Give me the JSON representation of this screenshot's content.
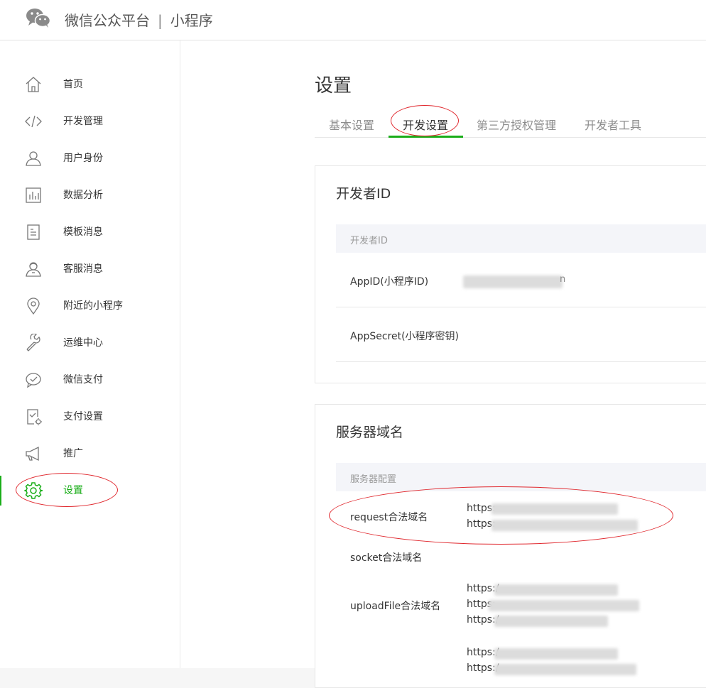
{
  "header": {
    "logo_icon": "wechat-logo-icon",
    "platform_name": "微信公众平台",
    "separator": "|",
    "product_name": "小程序"
  },
  "sidebar": {
    "items": [
      {
        "label": "首页",
        "icon": "home-icon"
      },
      {
        "label": "开发管理",
        "icon": "code-icon"
      },
      {
        "label": "用户身份",
        "icon": "user-icon"
      },
      {
        "label": "数据分析",
        "icon": "bar-chart-icon"
      },
      {
        "label": "模板消息",
        "icon": "document-icon"
      },
      {
        "label": "客服消息",
        "icon": "customer-service-icon"
      },
      {
        "label": "附近的小程序",
        "icon": "location-pin-icon"
      },
      {
        "label": "运维中心",
        "icon": "wrench-icon"
      },
      {
        "label": "微信支付",
        "icon": "wechat-pay-icon"
      },
      {
        "label": "支付设置",
        "icon": "payment-settings-icon"
      },
      {
        "label": "推广",
        "icon": "megaphone-icon"
      },
      {
        "label": "设置",
        "icon": "gear-icon",
        "active": true
      }
    ]
  },
  "main": {
    "title": "设置",
    "tabs": [
      {
        "label": "基本设置"
      },
      {
        "label": "开发设置",
        "active": true
      },
      {
        "label": "第三方授权管理"
      },
      {
        "label": "开发者工具"
      }
    ],
    "dev_card": {
      "title": "开发者ID",
      "table_header": "开发者ID",
      "rows": [
        {
          "label": "AppID(小程序ID)",
          "value_partial": "n"
        },
        {
          "label": "AppSecret(小程序密钥)"
        }
      ]
    },
    "server_card": {
      "title": "服务器域名",
      "table_header": "服务器配置",
      "rows": [
        {
          "label": "request合法域名",
          "urls": [
            "https:",
            "https:"
          ]
        },
        {
          "label": "socket合法域名",
          "urls": []
        },
        {
          "label": "uploadFile合法域名",
          "urls": [
            "https:/",
            "https:",
            "https:/"
          ]
        },
        {
          "label": "",
          "urls": [
            "https:/",
            "https:/"
          ]
        }
      ]
    }
  },
  "colors": {
    "accent_green": "#1aad19",
    "annotation_red": "#e0272d"
  }
}
